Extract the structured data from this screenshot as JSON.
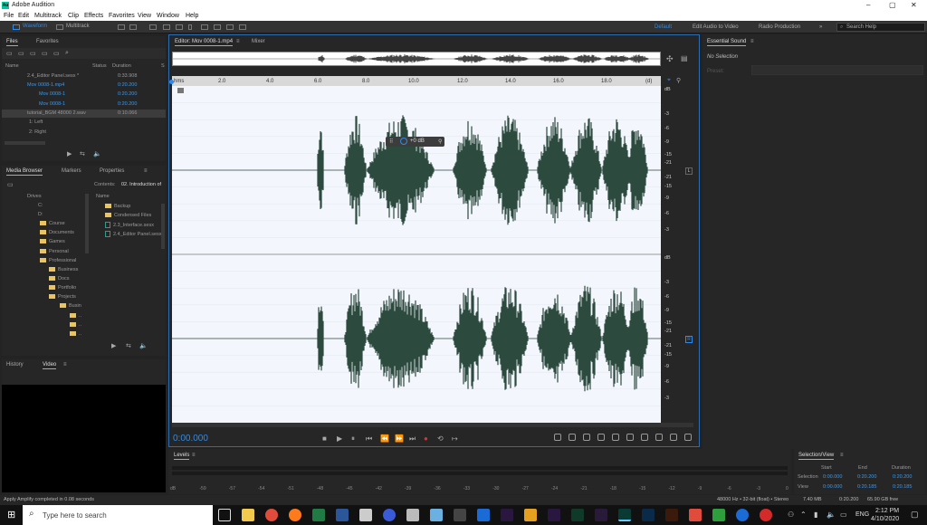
{
  "window": {
    "title": "Adobe Audition",
    "minimize": "–",
    "maximize": "▢",
    "close": "✕"
  },
  "menu": [
    "File",
    "Edit",
    "Multitrack",
    "Clip",
    "Effects",
    "Favorites",
    "View",
    "Window",
    "Help"
  ],
  "toolbar": {
    "waveform": "Waveform",
    "multitrack": "Multitrack"
  },
  "workspaces": [
    "Default",
    "Edit Audio to Video",
    "Radio Production"
  ],
  "workspace_more": "»",
  "search_placeholder": "Search Help",
  "files_panel": {
    "tabs": [
      "Files",
      "Favorites"
    ],
    "columns": [
      "Name",
      "Status",
      "Duration",
      "S"
    ],
    "rows": [
      {
        "name": "2.4_Editor Panel.sesx *",
        "duration": "0:33.908"
      },
      {
        "name": "Mov 0008-1.mp4",
        "duration": "0:20.200"
      },
      {
        "name": "Mov 0008-1",
        "duration": "0:20.200"
      },
      {
        "name": "Mov 0008-1",
        "duration": "0:20.200"
      },
      {
        "name": "tutorial_BGM 48000 2.wav",
        "duration": "0:10.066"
      },
      {
        "name": "1: Left",
        "duration": ""
      },
      {
        "name": "2: Right",
        "duration": ""
      }
    ]
  },
  "media_panel": {
    "tabs": [
      "Media Browser",
      "Markers",
      "Properties"
    ],
    "tab_more": "≡",
    "contents_label": "Contents:",
    "contents_value": "02. Introduction of",
    "name_col": "Name",
    "tree": [
      "Drives",
      "C:",
      "D:",
      "Course",
      "Documents",
      "Games",
      "Personal",
      "Professional",
      "Business",
      "Docs",
      "Portfolio",
      "Projects",
      "Busin",
      "..",
      "..",
      ".."
    ],
    "files": [
      "Backup",
      "Condensed Files",
      "2.3_Interface.sesx",
      "2.4_Editor Panel.sesx"
    ]
  },
  "lower_left": {
    "tabs": [
      "History",
      "Video"
    ],
    "video_more": "≡"
  },
  "editor": {
    "tab": "Editor: Mov 0008-1.mp4",
    "tab_more": "≡",
    "mixer": "Mixer",
    "ruler": [
      "hms",
      "2.0",
      "4.0",
      "6.0",
      "8.0",
      "10.0",
      "12.0",
      "14.0",
      "16.0",
      "18.0",
      "(d)"
    ],
    "hud": "+0 dB",
    "db_top": [
      "dB",
      "-3",
      "-6",
      "-9",
      "-15",
      "-21",
      "-21",
      "-15",
      "-9",
      "-6",
      "-3"
    ],
    "db_bottom": [
      "dB",
      "-3",
      "-6",
      "-9",
      "-15",
      "-21",
      "-21",
      "-15",
      "-9",
      "-6",
      "-3"
    ],
    "channel_l": "L",
    "channel_r": "R",
    "time": "0:00.000"
  },
  "essential_sound": {
    "title": "Essential Sound",
    "more": "≡",
    "no_selection": "No Selection",
    "preset": "Preset:"
  },
  "levels": {
    "title": "Levels",
    "more": "≡",
    "scale": [
      "dB",
      "-59",
      "-57",
      "-54",
      "-51",
      "-48",
      "-45",
      "-42",
      "-39",
      "-36",
      "-33",
      "-30",
      "-27",
      "-24",
      "-21",
      "-18",
      "-15",
      "-12",
      "-9",
      "-6",
      "-3",
      "0"
    ]
  },
  "selection_view": {
    "title": "Selection/View",
    "more": "≡",
    "headers": [
      "Start",
      "End",
      "Duration"
    ],
    "rows": [
      {
        "label": "Selection",
        "start": "0:00.000",
        "end": "0:20.200",
        "duration": "0:20.200"
      },
      {
        "label": "View",
        "start": "0:00.000",
        "end": "0:20.185",
        "duration": "0:20.185"
      }
    ]
  },
  "status": {
    "left": "Apply Amplify completed in 0.08 seconds",
    "format": "48000 Hz • 32-bit (float) • Stereo",
    "size": "7.40 MB",
    "duration": "0:20.200",
    "free": "65.90 GB free"
  },
  "taskbar": {
    "search": "Type here to search",
    "lang": "ENG",
    "time": "2:12 PM",
    "date": "4/10/2020"
  },
  "colors": {
    "accent": "#2d8ceb",
    "wave": "#2d4a3e",
    "wavebg": "#f3f6fc"
  }
}
